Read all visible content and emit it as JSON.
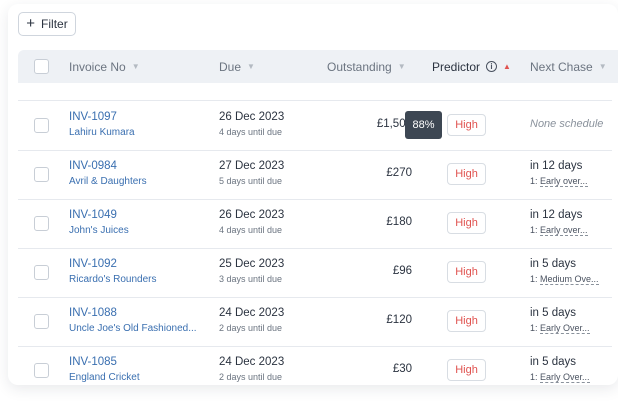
{
  "toolbar": {
    "filter_label": "Filter"
  },
  "columns": {
    "invoice_no": "Invoice No",
    "due": "Due",
    "outstanding": "Outstanding",
    "predictor": "Predictor",
    "next_chase": "Next Chase"
  },
  "rows": [
    {
      "invoice": "INV-1097",
      "customer": "Lahiru Kumara",
      "due": "26 Dec 2023",
      "due_sub": "4 days until due",
      "amount": "£1,500",
      "predictor_pct": "88%",
      "predictor": "High",
      "chase": "",
      "chase_sub": "",
      "chase_none": "None schedule"
    },
    {
      "invoice": "INV-0984",
      "customer": "Avril & Daughters",
      "due": "27 Dec 2023",
      "due_sub": "5 days until due",
      "amount": "£270",
      "predictor": "High",
      "chase": "in 12 days",
      "chase_prefix": "1:",
      "chase_link": "Early over..."
    },
    {
      "invoice": "INV-1049",
      "customer": "John's Juices",
      "due": "26 Dec 2023",
      "due_sub": "4 days until due",
      "amount": "£180",
      "predictor": "High",
      "chase": "in 12 days",
      "chase_prefix": "1:",
      "chase_link": "Early over..."
    },
    {
      "invoice": "INV-1092",
      "customer": "Ricardo's Rounders",
      "due": "25 Dec 2023",
      "due_sub": "3 days until due",
      "amount": "£96",
      "predictor": "High",
      "chase": "in 5 days",
      "chase_prefix": "1:",
      "chase_link": "Medium Ove..."
    },
    {
      "invoice": "INV-1088",
      "customer": "Uncle Joe's Old Fashioned...",
      "due": "24 Dec 2023",
      "due_sub": "2 days until due",
      "amount": "£120",
      "predictor": "High",
      "chase": "in 5 days",
      "chase_prefix": "1:",
      "chase_link": "Early Over..."
    },
    {
      "invoice": "INV-1085",
      "customer": "England Cricket",
      "due": "24 Dec 2023",
      "due_sub": "2 days until due",
      "amount": "£30",
      "predictor": "High",
      "chase": "in 5 days",
      "chase_prefix": "1:",
      "chase_link": "Early Over..."
    }
  ],
  "colors": {
    "link": "#3a6fb0",
    "high": "#e0524f",
    "header_bg": "#eef1f5",
    "tooltip": "#3d4753"
  }
}
